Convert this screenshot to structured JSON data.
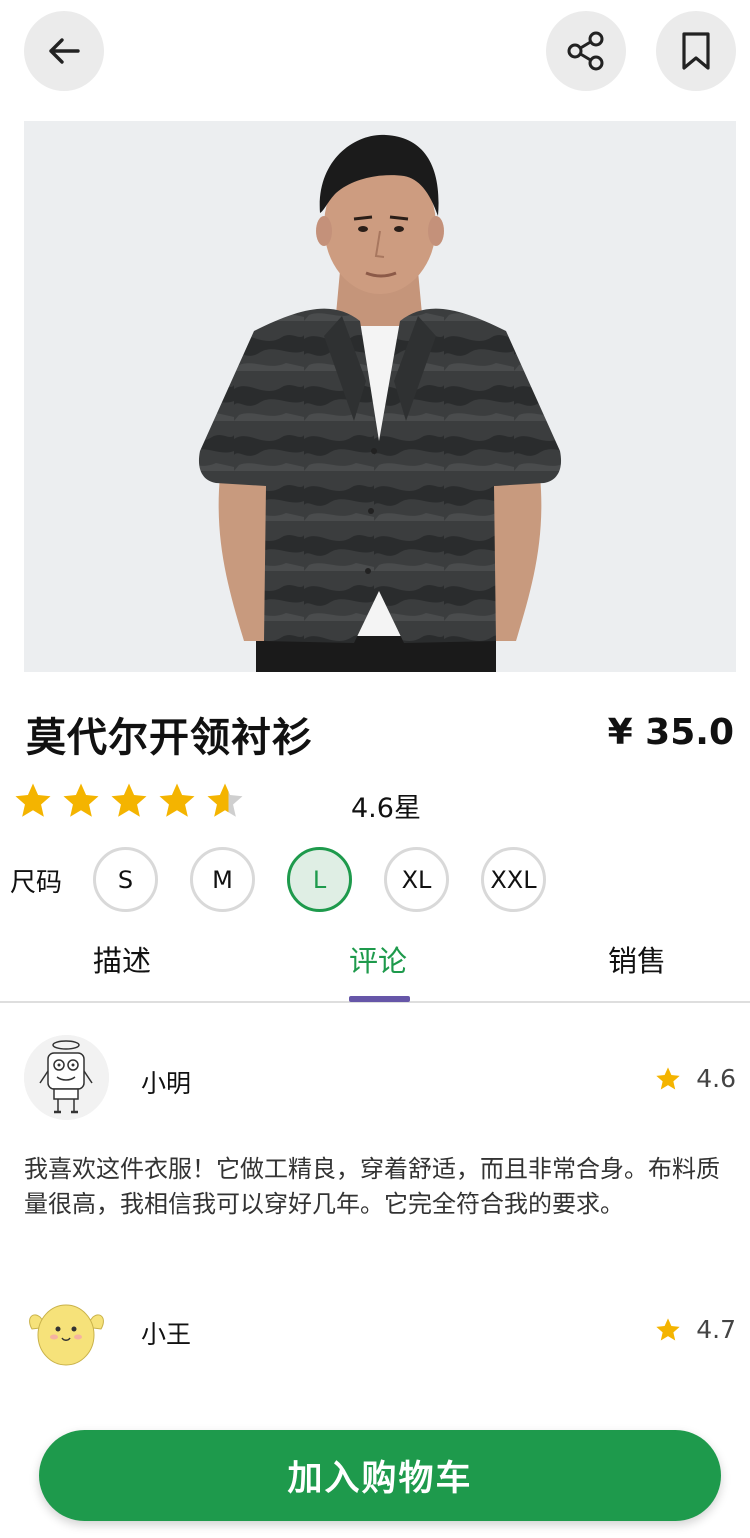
{
  "header": {
    "back_icon": "arrow-left-icon",
    "share_icon": "share-icon",
    "bookmark_icon": "bookmark-icon"
  },
  "product": {
    "image_alt": "Man wearing dark camo-pattern open-collar short-sleeve shirt",
    "title": "莫代尔开领衬衫",
    "price": "¥ 35.0",
    "rating": 4.6,
    "rating_text": "4.6星",
    "star_color": "#f4b400"
  },
  "sizes": {
    "label": "尺码",
    "options": [
      "S",
      "M",
      "L",
      "XL",
      "XXL"
    ],
    "selected": "L"
  },
  "tabs": {
    "items": [
      "描述",
      "评论",
      "销售"
    ],
    "active": "评论",
    "active_color": "#1e9a4c",
    "indicator_color": "#6656a8"
  },
  "reviews": [
    {
      "name": "小明",
      "rating": "4.6",
      "avatar_icon": "spongebob-avatar",
      "text": "我喜欢这件衣服！它做工精良，穿着舒适，而且非常合身。布料质量很高，我相信我可以穿好几年。它完全符合我的要求。"
    },
    {
      "name": "小王",
      "rating": "4.7",
      "avatar_icon": "yellow-chick-avatar",
      "text": ""
    }
  ],
  "cart": {
    "label": "加入购物车",
    "color": "#1e9a4c"
  }
}
